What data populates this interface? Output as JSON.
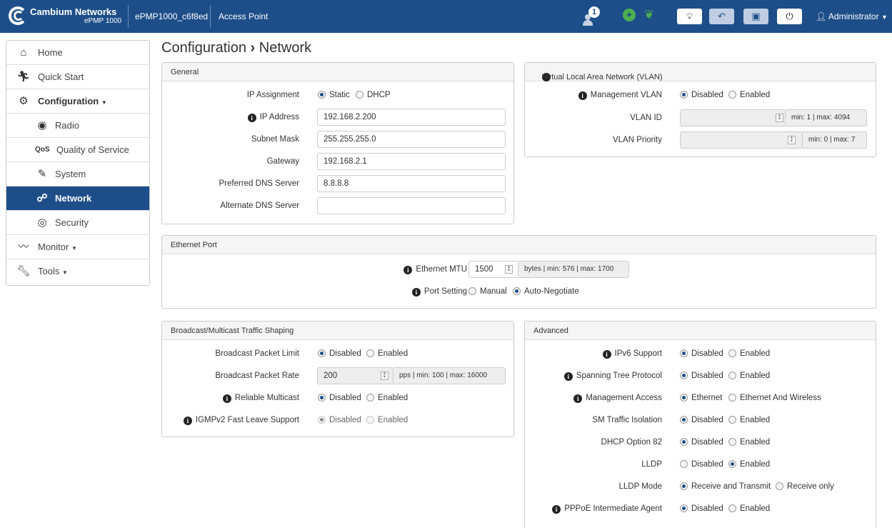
{
  "topbar": {
    "brand": "Cambium Networks",
    "model": "ePMP 1000",
    "device_name": "ePMP1000_c6f8ed",
    "mode": "Access Point",
    "alert_count": "1",
    "user": "Administrator"
  },
  "sidebar": {
    "items": [
      {
        "label": "Home",
        "icon": "home-icon"
      },
      {
        "label": "Quick Start",
        "icon": "running-person-icon"
      },
      {
        "label": "Configuration",
        "icon": "gear-icon"
      },
      {
        "label": "Radio",
        "icon": "radio-icon"
      },
      {
        "label": "Quality of Service",
        "icon": "qos-icon"
      },
      {
        "label": "System",
        "icon": "system-icon"
      },
      {
        "label": "Network",
        "icon": "network-icon"
      },
      {
        "label": "Security",
        "icon": "security-icon"
      },
      {
        "label": "Monitor",
        "icon": "pulse-icon"
      },
      {
        "label": "Tools",
        "icon": "wrench-icon"
      }
    ]
  },
  "page": {
    "title_section": "Configuration",
    "title_page": "Network",
    "separator": "›"
  },
  "general": {
    "title": "General",
    "ip_assignment_label": "IP Assignment",
    "ip_assignment_options": [
      "Static",
      "DHCP"
    ],
    "ip_assignment_selected": "Static",
    "ip_address_label": "IP Address",
    "ip_address_value": "192.168.2.200",
    "subnet_label": "Subnet Mask",
    "subnet_value": "255.255.255.0",
    "gateway_label": "Gateway",
    "gateway_value": "192.168.2.1",
    "pref_dns_label": "Preferred DNS Server",
    "pref_dns_value": "8.8.8.8",
    "alt_dns_label": "Alternate DNS Server",
    "alt_dns_value": ""
  },
  "vlan": {
    "title": "Virtual Local Area Network (VLAN)",
    "mgmt_label": "Management VLAN",
    "options": [
      "Disabled",
      "Enabled"
    ],
    "mgmt_selected": "Disabled",
    "vlan_id_label": "VLAN ID",
    "vlan_id_range": "min: 1 | max: 4094",
    "vlan_priority_label": "VLAN Priority",
    "vlan_priority_range": "min: 0 | max: 7"
  },
  "ethernet": {
    "title": "Ethernet Port",
    "mtu_label": "Ethernet MTU",
    "mtu_value": "1500",
    "mtu_range": "bytes | min: 576 | max: 1700",
    "port_label": "Port Setting",
    "port_options": [
      "Manual",
      "Auto-Negotiate"
    ],
    "port_selected": "Auto-Negotiate"
  },
  "broadcast": {
    "title": "Broadcast/Multicast Traffic Shaping",
    "limit_label": "Broadcast Packet Limit",
    "options": [
      "Disabled",
      "Enabled"
    ],
    "limit_selected": "Disabled",
    "rate_label": "Broadcast Packet Rate",
    "rate_value": "200",
    "rate_range": "pps | min: 100 | max: 16000",
    "reliable_label": "Reliable Multicast",
    "reliable_selected": "Disabled",
    "igmp_label": "IGMPv2 Fast Leave Support",
    "igmp_selected": "Disabled"
  },
  "advanced": {
    "title": "Advanced",
    "options": [
      "Disabled",
      "Enabled"
    ],
    "ipv6_label": "IPv6 Support",
    "ipv6_selected": "Disabled",
    "stp_label": "Spanning Tree Protocol",
    "stp_selected": "Disabled",
    "mgmt_access_label": "Management Access",
    "mgmt_access_options": [
      "Ethernet",
      "Ethernet And Wireless"
    ],
    "mgmt_access_selected": "Ethernet",
    "sm_isolation_label": "SM Traffic Isolation",
    "sm_isolation_selected": "Disabled",
    "dhcp82_label": "DHCP Option 82",
    "dhcp82_selected": "Disabled",
    "lldp_label": "LLDP",
    "lldp_selected": "Enabled",
    "lldp_mode_label": "LLDP Mode",
    "lldp_mode_options": [
      "Receive and Transmit",
      "Receive only"
    ],
    "lldp_mode_selected": "Receive and Transmit",
    "pppoe_label": "PPPoE Intermediate Agent",
    "pppoe_selected": "Disabled"
  },
  "colors": {
    "primary": "#1d4e89",
    "accent_green": "#4caf50",
    "panel_header": "#f5f5f5"
  }
}
